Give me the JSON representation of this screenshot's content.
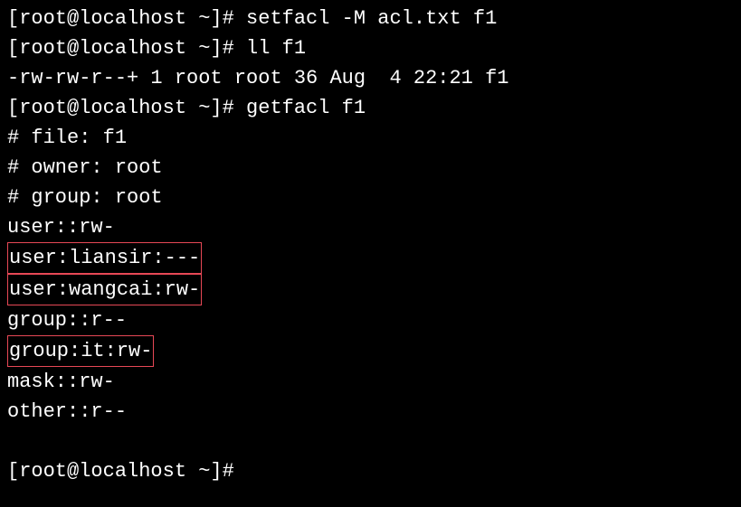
{
  "lines": {
    "l1_prompt": "[root@localhost ~]# ",
    "l1_cmd": "setfacl -M acl.txt f1",
    "l2_prompt": "[root@localhost ~]# ",
    "l2_cmd": "ll f1",
    "l3_out": "-rw-rw-r--+ 1 root root 36 Aug  4 22:21 f1",
    "l4_prompt": "[root@localhost ~]# ",
    "l4_cmd": "getfacl f1",
    "l5_out": "# file: f1",
    "l6_out": "# owner: root",
    "l7_out": "# group: root",
    "l8_out": "user::rw-",
    "l9_out": "user:liansir:---",
    "l10_out": "user:wangcai:rw-",
    "l11_out": "group::r--",
    "l12_out": "group:it:rw-",
    "l13_out": "mask::rw-",
    "l14_out": "other::r--",
    "l15_blank": " ",
    "l16_prompt": "[root@localhost ~]# "
  }
}
